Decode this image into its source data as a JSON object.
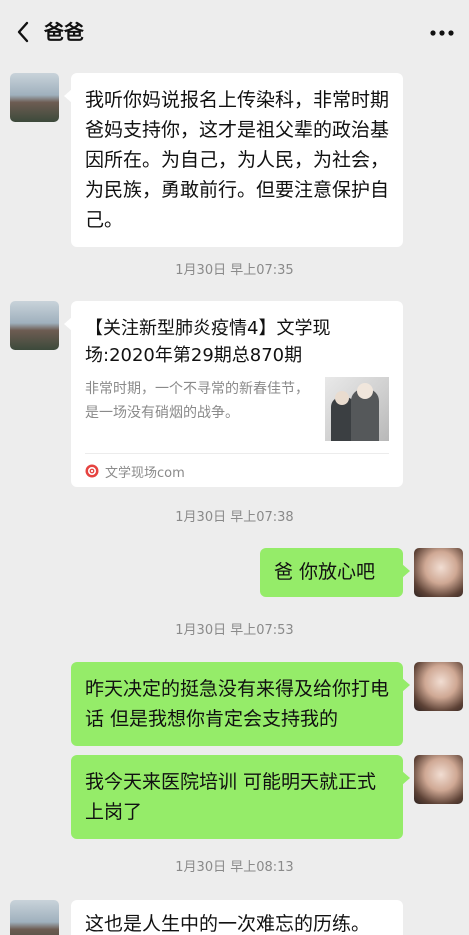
{
  "header": {
    "title": "爸爸"
  },
  "messages": [
    {
      "text": "我听你妈说报名上传染科，非常时期爸妈支持你，这才是祖父辈的政治基因所在。为自己，为人民，为社会，为民族，勇敢前行。但要注意保护自己。"
    },
    {
      "timestamp": "1月30日 早上07:35"
    },
    {
      "card": {
        "title": "【关注新型肺炎疫情4】文学现场:2020年第29期总870期",
        "description": "非常时期，一个不寻常的新春佳节，是一场没有硝烟的战争。",
        "source": "文学现场com"
      }
    },
    {
      "timestamp": "1月30日 早上07:38"
    },
    {
      "text": "爸 你放心吧"
    },
    {
      "timestamp": "1月30日 早上07:53"
    },
    {
      "text": "昨天决定的挺急没有来得及给你打电话  但是我想你肯定会支持我的"
    },
    {
      "text": "我今天来医院培训  可能明天就正式上岗了"
    },
    {
      "timestamp": "1月30日 早上08:13"
    },
    {
      "text": "这也是人生中的一次难忘的历练。"
    }
  ],
  "colors": {
    "background": "#ededed",
    "incoming_bubble": "#ffffff",
    "outgoing_bubble": "#95ec69",
    "timestamp_text": "#8a8a8a",
    "source_icon": "#e64340"
  },
  "icons": {
    "back": "chevron-left-icon",
    "more": "more-icon",
    "source": "source-logo-icon"
  }
}
